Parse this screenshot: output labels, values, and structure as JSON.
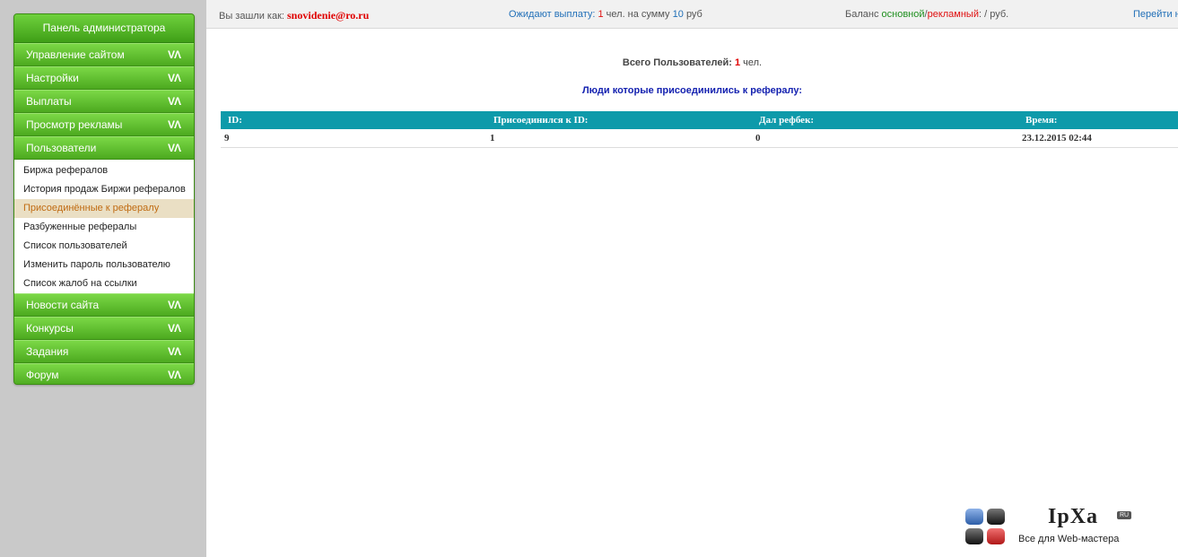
{
  "topbar": {
    "login_label": "Вы зашли как:",
    "login_user": "snovidenie@ro.ru",
    "pending_label": "Ожидают выплату:",
    "pending_count": "1",
    "pending_mid": "чел. на сумму",
    "pending_sum": "10",
    "pending_unit": "руб",
    "balance_label": "Баланс",
    "balance_main": "основной",
    "balance_slash": "/",
    "balance_ad": "рекламный",
    "balance_colon": ":",
    "balance_unit": "/ руб.",
    "goto_link": "Перейти н"
  },
  "sidebar": {
    "title": "Панель администратора",
    "arrows": "VΛ",
    "menu_top": [
      {
        "label": "Управление сайтом"
      },
      {
        "label": "Настройки"
      },
      {
        "label": "Выплаты"
      },
      {
        "label": "Просмотр рекламы"
      },
      {
        "label": "Пользователи"
      }
    ],
    "submenu": [
      {
        "label": "Биржа рефералов"
      },
      {
        "label": "История продаж Биржи рефералов"
      },
      {
        "label": "Присоединённые к рефералу"
      },
      {
        "label": "Разбуженные рефералы"
      },
      {
        "label": "Список пользователей"
      },
      {
        "label": "Изменить пароль пользователю"
      },
      {
        "label": "Список жалоб на ссылки"
      }
    ],
    "menu_bottom": [
      {
        "label": "Новости сайта"
      },
      {
        "label": "Конкурсы"
      },
      {
        "label": "Задания"
      },
      {
        "label": "Форум"
      }
    ]
  },
  "main": {
    "total_label": "Всего Пользователей:",
    "total_count": "1",
    "total_unit": "чел.",
    "list_title": "Люди которые присоединились к рефералу:",
    "table": {
      "headers": [
        "ID:",
        "Присоединился к ID:",
        "Дал рефбек:",
        "Время:"
      ],
      "rows": [
        [
          "9",
          "1",
          "0",
          "23.12.2015 02:44"
        ]
      ]
    }
  },
  "logo": {
    "title": "IpXa",
    "badge": "RU",
    "subtitle": "Все для Web-мастера"
  }
}
